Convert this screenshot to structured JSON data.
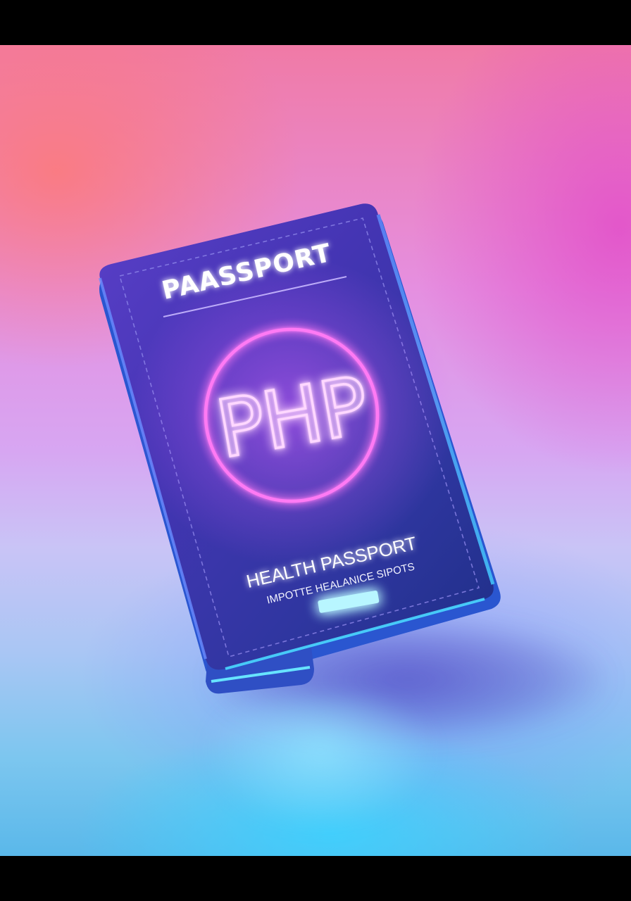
{
  "cover": {
    "title": "PAASSPORT",
    "emblem_text": "PHP",
    "caption": "HEALTH PASSPORT",
    "subcaption": "IMPOTTE HEALANICE SIPOTS"
  },
  "colors": {
    "background_top": "#f07aa6",
    "background_bottom": "#5ab8ea",
    "cover": "#3a3aa8",
    "neon_glow": "#ff5cf0",
    "light_strip": "#9ff0ff"
  }
}
